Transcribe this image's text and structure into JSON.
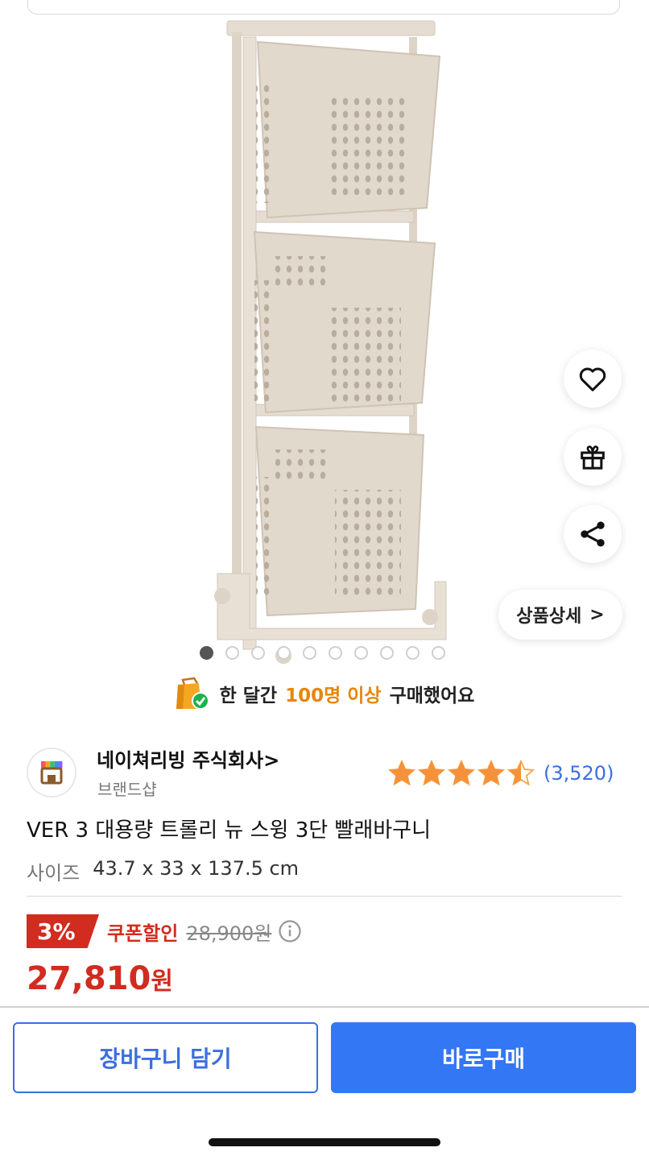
{
  "image_carousel": {
    "total": 10,
    "active_index": 0
  },
  "actions": {
    "favorite_icon": "heart-icon",
    "gift_icon": "gift-icon",
    "share_icon": "share-icon",
    "detail_label": "상품상세",
    "detail_arrow": ">"
  },
  "purchase_banner": {
    "prefix": "한 달간",
    "highlight": "100명 이상",
    "suffix": "구매했어요"
  },
  "store": {
    "name": "네이쳐리빙 주식회사",
    "arrow": ">",
    "type": "브랜드샵"
  },
  "rating": {
    "stars": 4.5,
    "count_text": "(3,520)"
  },
  "product": {
    "title": "VER 3 대용량 트롤리 뉴 스윙 3단 빨래바구니",
    "spec_label": "사이즈",
    "spec_value": "43.7 x 33 x 137.5 cm"
  },
  "price": {
    "discount_badge": "3%",
    "coupon_label": "쿠폰할인",
    "original": "28,900원",
    "final_number": "27,810",
    "final_unit": "원"
  },
  "bottom_bar": {
    "cart_label": "장바구니 담기",
    "buy_label": "바로구매"
  },
  "colors": {
    "accent_blue": "#3477f5",
    "sale_red": "#d22b1f",
    "highlight_orange": "#e6860b",
    "product_beige": "#e2d9cd"
  }
}
